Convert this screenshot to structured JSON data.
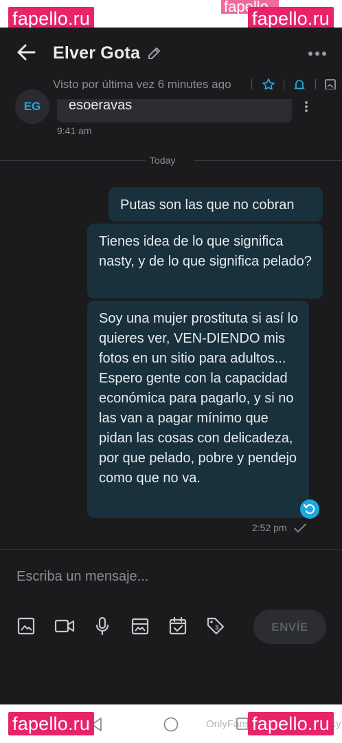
{
  "watermark": {
    "text": "fapello.ru",
    "ghost": "fapello"
  },
  "header": {
    "title": "Elver Gota",
    "last_seen": "Visto por última vez 6 minutes ago"
  },
  "messages": {
    "previous": {
      "avatar_initials": "EG",
      "text": "esoeravas",
      "time": "9:41 am"
    },
    "date_divider": "Today",
    "outgoing": [
      {
        "text": "Putas son las que no cobran"
      },
      {
        "text": "Tienes idea de lo que significa nasty, y de lo que significa pelado?"
      },
      {
        "text": "Soy una mujer prostituta si así lo quieres ver, VEN-DIENDO mis fotos en un sitio para adultos... Espero gente con la capacidad económica para pagarlo, y si no las van a pagar mínimo que pidan las cosas con delicadeza, por que pelado, pobre y pendejo como que no va."
      }
    ],
    "outgoing_time": "2:52 pm"
  },
  "composer": {
    "placeholder": "Escriba un mensaje...",
    "send_label": "ENVÍE",
    "tools": [
      "image-icon",
      "video-icon",
      "microphone-icon",
      "vault-icon",
      "calendar-icon",
      "price-tag-icon"
    ]
  },
  "navbar": {
    "watermark_text": "OnlyFans.com/chubbychunky"
  },
  "colors": {
    "accent": "#1fa8e0",
    "bubble_out": "#18313d",
    "background": "#1b1b1d",
    "watermark": "#e8236a"
  }
}
